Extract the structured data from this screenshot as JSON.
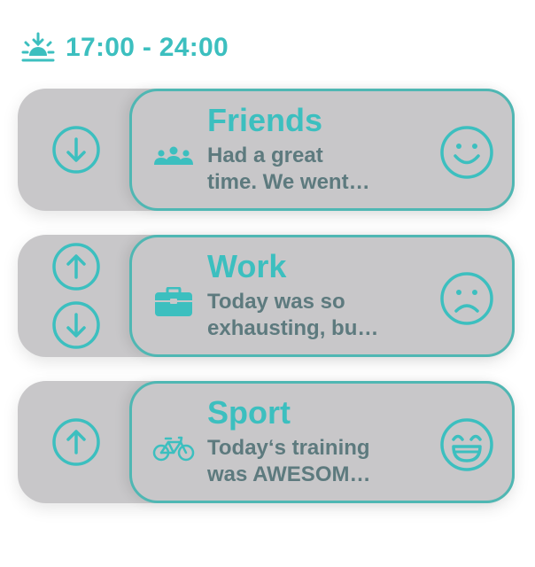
{
  "header": {
    "time_range": "17:00 - 24:00",
    "icon": "sunset-icon"
  },
  "accent_color": "#3cbfbf",
  "entries": [
    {
      "title": "Friends",
      "category_icon": "people-icon",
      "text_line1": "Had a great",
      "text_line2": "time. We went…",
      "mood": "happy",
      "arrows": [
        "down"
      ]
    },
    {
      "title": "Work",
      "category_icon": "briefcase-icon",
      "text_line1": "Today was so",
      "text_line2": "exhausting, bu…",
      "mood": "sad",
      "arrows": [
        "up",
        "down"
      ]
    },
    {
      "title": "Sport",
      "category_icon": "bicycle-icon",
      "text_line1": "Today‘s training",
      "text_line2": "was AWESOM…",
      "mood": "very-happy",
      "arrows": [
        "up"
      ]
    }
  ]
}
